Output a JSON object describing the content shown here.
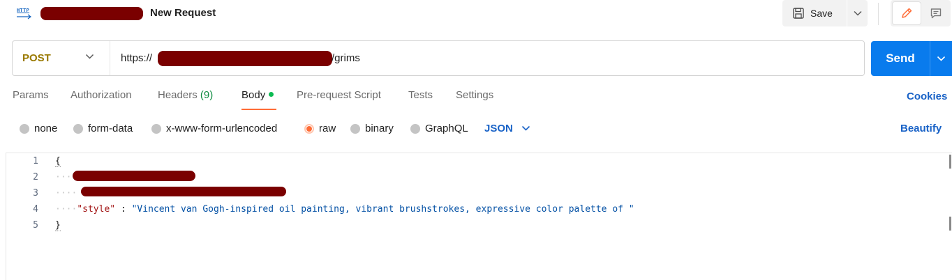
{
  "header": {
    "icon_label": "HTTP",
    "request_title": "New Request",
    "save_label": "Save"
  },
  "request": {
    "method": "POST",
    "url_prefix": "https://",
    "url_suffix": "/grims",
    "send_label": "Send"
  },
  "tabs": [
    {
      "label": "Params"
    },
    {
      "label": "Authorization"
    },
    {
      "label": "Headers",
      "count": "(9)"
    },
    {
      "label": "Body",
      "active": true
    },
    {
      "label": "Pre-request Script"
    },
    {
      "label": "Tests"
    },
    {
      "label": "Settings"
    }
  ],
  "cookies_label": "Cookies",
  "body_types": [
    {
      "label": "none"
    },
    {
      "label": "form-data"
    },
    {
      "label": "x-www-form-urlencoded"
    },
    {
      "label": "raw",
      "selected": true
    },
    {
      "label": "binary"
    },
    {
      "label": "GraphQL"
    }
  ],
  "format_select": "JSON",
  "beautify_label": "Beautify",
  "editor": {
    "line_numbers": [
      "1",
      "2",
      "3",
      "4",
      "5"
    ],
    "line1": "{",
    "line4_key": "\"style\"",
    "line4_sep": " : ",
    "line4_value": "\"Vincent van Gogh-inspired oil painting, vibrant brushstrokes, expressive color palette of \"",
    "line5": "}"
  },
  "colors": {
    "accent": "#ff6c37",
    "send_button": "#097bed",
    "link_blue": "#1a63c7",
    "method_post": "#9a7a00",
    "body_dot": "#0cbb52",
    "redaction": "#7a0000"
  }
}
